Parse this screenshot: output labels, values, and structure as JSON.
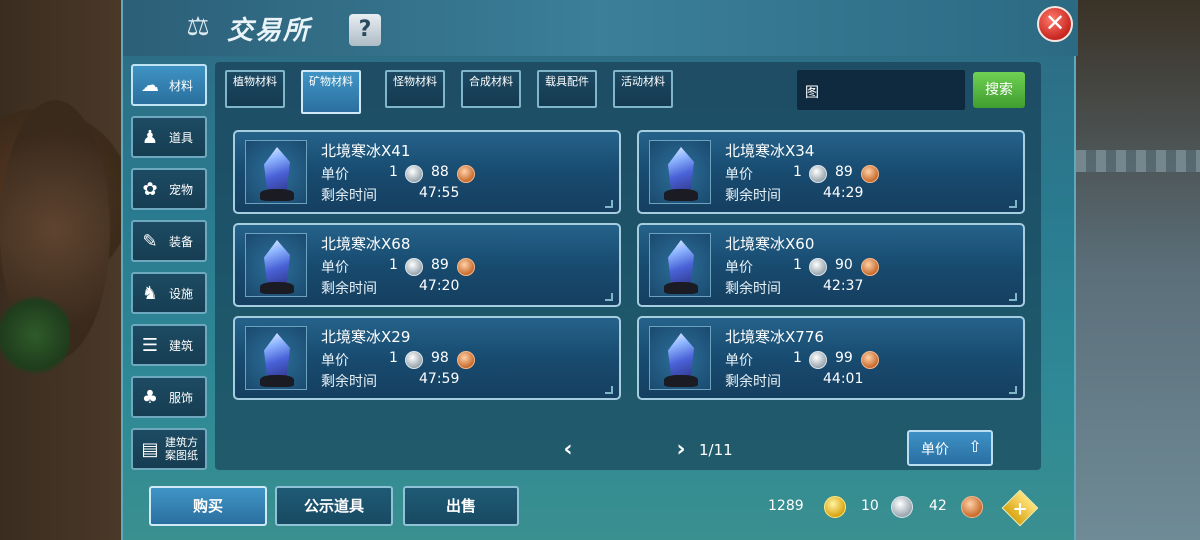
{
  "window": {
    "title": "交易所",
    "help_label": "?",
    "close_label": "✕"
  },
  "categories": [
    {
      "label": "材料",
      "icon": "materials-icon",
      "active": true
    },
    {
      "label": "道具",
      "icon": "item-icon",
      "active": false
    },
    {
      "label": "宠物",
      "icon": "pet-paw-icon",
      "active": false
    },
    {
      "label": "装备",
      "icon": "equipment-icon",
      "active": false
    },
    {
      "label": "设施",
      "icon": "facility-icon",
      "active": false
    },
    {
      "label": "建筑",
      "icon": "building-icon",
      "active": false
    },
    {
      "label": "服饰",
      "icon": "clothing-icon",
      "active": false
    },
    {
      "label": "建筑方案图纸",
      "icon": "blueprint-icon",
      "active": false
    }
  ],
  "subtabs": [
    {
      "label": "植物材料",
      "active": false
    },
    {
      "label": "矿物材料",
      "active": true
    },
    {
      "label": "怪物材料",
      "active": false
    },
    {
      "label": "合成材料",
      "active": false
    },
    {
      "label": "载具配件",
      "active": false
    },
    {
      "label": "活动材料",
      "active": false
    }
  ],
  "search": {
    "value": "图",
    "button_label": "搜索"
  },
  "labels": {
    "unit_price": "单价",
    "remaining_time": "剩余时间"
  },
  "listings": [
    {
      "name": "北境寒冰X41",
      "silver": "1",
      "copper": "88",
      "time": "47:55"
    },
    {
      "name": "北境寒冰X34",
      "silver": "1",
      "copper": "89",
      "time": "44:29"
    },
    {
      "name": "北境寒冰X68",
      "silver": "1",
      "copper": "89",
      "time": "47:20"
    },
    {
      "name": "北境寒冰X60",
      "silver": "1",
      "copper": "90",
      "time": "42:37"
    },
    {
      "name": "北境寒冰X29",
      "silver": "1",
      "copper": "98",
      "time": "47:59"
    },
    {
      "name": "北境寒冰X776",
      "silver": "1",
      "copper": "99",
      "time": "44:01"
    }
  ],
  "pager": {
    "text": "1/11",
    "prev": "‹",
    "next": "›"
  },
  "sort": {
    "label": "单价",
    "arrow": "⇧"
  },
  "bottom_buttons": {
    "buy": "购买",
    "showcase": "公示道具",
    "sell": "出售"
  },
  "currency": {
    "gold": "1289",
    "silver": "10",
    "copper": "42",
    "add_label": "+"
  },
  "colors": {
    "accent_active": "#3f95c6",
    "search_green": "#5fbf45",
    "close_red": "#c82620"
  }
}
